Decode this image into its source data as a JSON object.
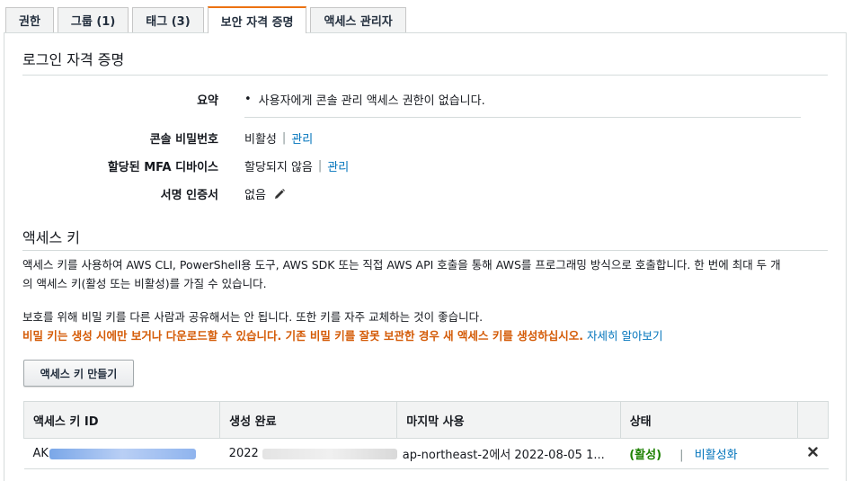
{
  "tabs": [
    {
      "label": "권한"
    },
    {
      "label": "그룹 (1)"
    },
    {
      "label": "태그 (3)"
    },
    {
      "label": "보안 자격 증명"
    },
    {
      "label": "액세스 관리자"
    }
  ],
  "login": {
    "title": "로그인 자격 증명",
    "summary_label": "요약",
    "summary_text": "사용자에게 콘솔 관리 액세스 권한이 없습니다.",
    "console_label": "콘솔 비밀번호",
    "console_value": "비활성",
    "console_link": "관리",
    "mfa_label": "할당된 MFA 디바이스",
    "mfa_value": "할당되지 않음",
    "mfa_link": "관리",
    "cert_label": "서명 인증서",
    "cert_value": "없음"
  },
  "access_keys": {
    "title": "액세스 키",
    "desc1": "액세스 키를 사용하여 AWS CLI, PowerShell용 도구, AWS SDK 또는 직접 AWS API 호출을 통해 AWS를 프로그래밍 방식으로 호출합니다. 한 번에 최대 두 개",
    "desc2": "의 액세스 키(활성 또는 비활성)를 가질 수 있습니다.",
    "protect": "보호를 위해 비밀 키를 다른 사람과 공유해서는 안 됩니다. 또한 키를 자주 교체하는 것이 좋습니다.",
    "warning": "비밀 키는 생성 시에만 보거나 다운로드할 수 있습니다. 기존 비밀 키를 잘못 보관한 경우 새 액세스 키를 생성하십시오.",
    "learn_more": "자세히 알아보기",
    "create_button": "액세스 키 만들기",
    "columns": [
      "액세스 키 ID",
      "생성 완료",
      "마지막 사용",
      "상태"
    ],
    "rows": [
      {
        "key_id": "AK",
        "created": "2022",
        "last_used": "ap-northeast-2에서 2022-08-05 1...",
        "status": "(활성)",
        "deactivate": "비활성화"
      }
    ]
  },
  "colors": {
    "accent": "#ec7211",
    "link": "#0073bb",
    "warning": "#d45b07",
    "active": "#1d8102"
  },
  "icons": [
    "pencil-icon",
    "delete-icon"
  ]
}
